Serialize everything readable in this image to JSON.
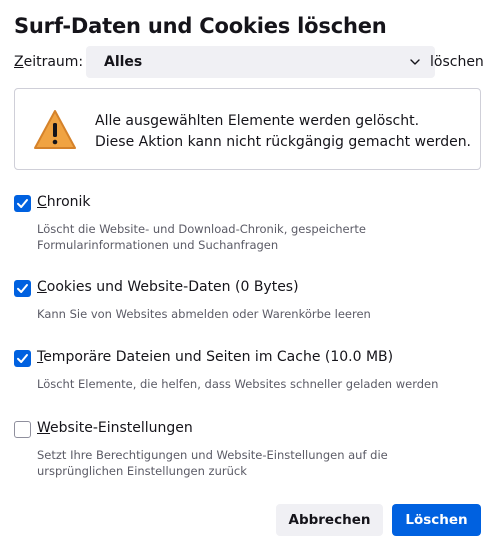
{
  "dialog": {
    "title": "Surf-Daten und Cookies löschen"
  },
  "range": {
    "label_accesskey": "Z",
    "label_rest": "eitraum:",
    "selected": "Alles",
    "suffix": "löschen"
  },
  "warning": {
    "line1": "Alle ausgewählten Elemente werden gelöscht.",
    "line2": "Diese Aktion kann nicht rückgängig gemacht werden.",
    "icon": "warning-triangle-icon"
  },
  "options": [
    {
      "accesskey": "C",
      "label_rest": "hronik",
      "checked": true,
      "desc1": "Löscht die Website- und Download-Chronik, gespeicherte",
      "desc2": "Formularinformationen und Suchanfragen"
    },
    {
      "accesskey": "C",
      "label_rest": "ookies und Website-Daten (0 Bytes)",
      "checked": true,
      "desc1": "Kann Sie von Websites abmelden oder Warenkörbe leeren",
      "desc2": ""
    },
    {
      "accesskey": "T",
      "label_rest": "emporäre Dateien und Seiten im Cache (10.0 MB)",
      "checked": true,
      "desc1": "Löscht Elemente, die helfen, dass Websites schneller geladen werden",
      "desc2": ""
    },
    {
      "accesskey": "W",
      "label_rest": "ebsite-Einstellungen",
      "checked": false,
      "desc1": "Setzt Ihre Berechtigungen und Website-Einstellungen auf die",
      "desc2": "ursprünglichen Einstellungen zurück"
    }
  ],
  "buttons": {
    "cancel": "Abbrechen",
    "clear": "Löschen"
  },
  "colors": {
    "accent": "#0061e0",
    "warning": "#f0a342"
  }
}
